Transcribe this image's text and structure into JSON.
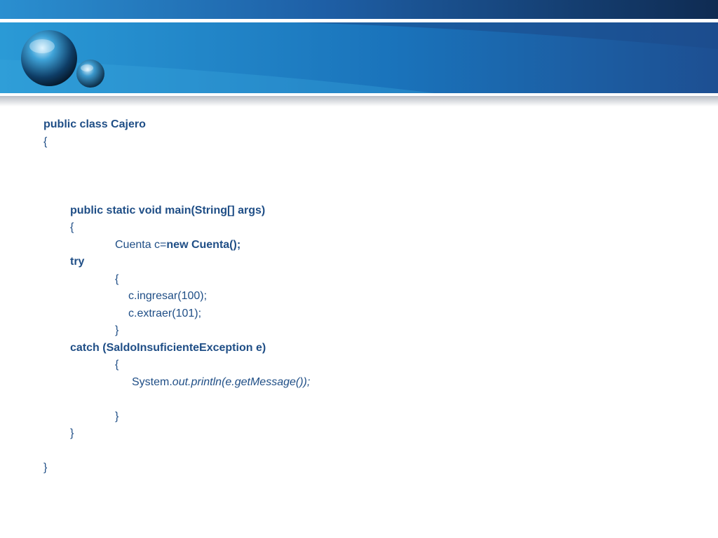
{
  "theme": {
    "text_color": "#1f4e86",
    "header_dark": "#0f2b52",
    "header_mid": "#1a6db5",
    "header_light": "#2a9ad6"
  },
  "header": {
    "decoration": "blue-orbs"
  },
  "code_lines": [
    {
      "indent": 0,
      "segments": [
        {
          "text": "public class Cajero",
          "bold": true,
          "italic": false
        }
      ]
    },
    {
      "indent": 0,
      "segments": [
        {
          "text": "{",
          "bold": false,
          "italic": false
        }
      ]
    },
    {
      "indent": 0,
      "segments": []
    },
    {
      "indent": 0,
      "segments": []
    },
    {
      "indent": 0,
      "segments": []
    },
    {
      "indent": 1,
      "segments": [
        {
          "text": "public static void main(String[] args)",
          "bold": true,
          "italic": false
        }
      ]
    },
    {
      "indent": 1,
      "segments": [
        {
          "text": "{",
          "bold": false,
          "italic": false
        }
      ]
    },
    {
      "indent": 2,
      "segments": [
        {
          "text": "Cuenta c=",
          "bold": false,
          "italic": false
        },
        {
          "text": "new Cuenta();",
          "bold": true,
          "italic": false
        }
      ]
    },
    {
      "indent": 1,
      "segments": [
        {
          "text": "try",
          "bold": true,
          "italic": false
        }
      ]
    },
    {
      "indent": 2,
      "segments": [
        {
          "text": "{",
          "bold": false,
          "italic": false
        }
      ]
    },
    {
      "indent": 3,
      "segments": [
        {
          "text": "c.ingresar(100);",
          "bold": false,
          "italic": false
        }
      ]
    },
    {
      "indent": 3,
      "segments": [
        {
          "text": "c.extraer(101);",
          "bold": false,
          "italic": false
        }
      ]
    },
    {
      "indent": 2,
      "segments": [
        {
          "text": "}",
          "bold": false,
          "italic": false
        }
      ]
    },
    {
      "indent": 1,
      "segments": [
        {
          "text": "catch (SaldoInsuficienteException e)",
          "bold": true,
          "italic": false
        }
      ]
    },
    {
      "indent": 2,
      "segments": [
        {
          "text": "{",
          "bold": false,
          "italic": false
        }
      ]
    },
    {
      "indent": 4,
      "segments": [
        {
          "text": "System.",
          "bold": false,
          "italic": false
        },
        {
          "text": "out.println(e.getMessage());",
          "bold": false,
          "italic": true
        }
      ]
    },
    {
      "indent": 0,
      "segments": []
    },
    {
      "indent": 2,
      "segments": [
        {
          "text": "}",
          "bold": false,
          "italic": false
        }
      ]
    },
    {
      "indent": 1,
      "segments": [
        {
          "text": "}",
          "bold": false,
          "italic": false
        }
      ]
    },
    {
      "indent": 0,
      "segments": []
    },
    {
      "indent": 0,
      "segments": [
        {
          "text": "}",
          "bold": false,
          "italic": false
        }
      ]
    }
  ]
}
